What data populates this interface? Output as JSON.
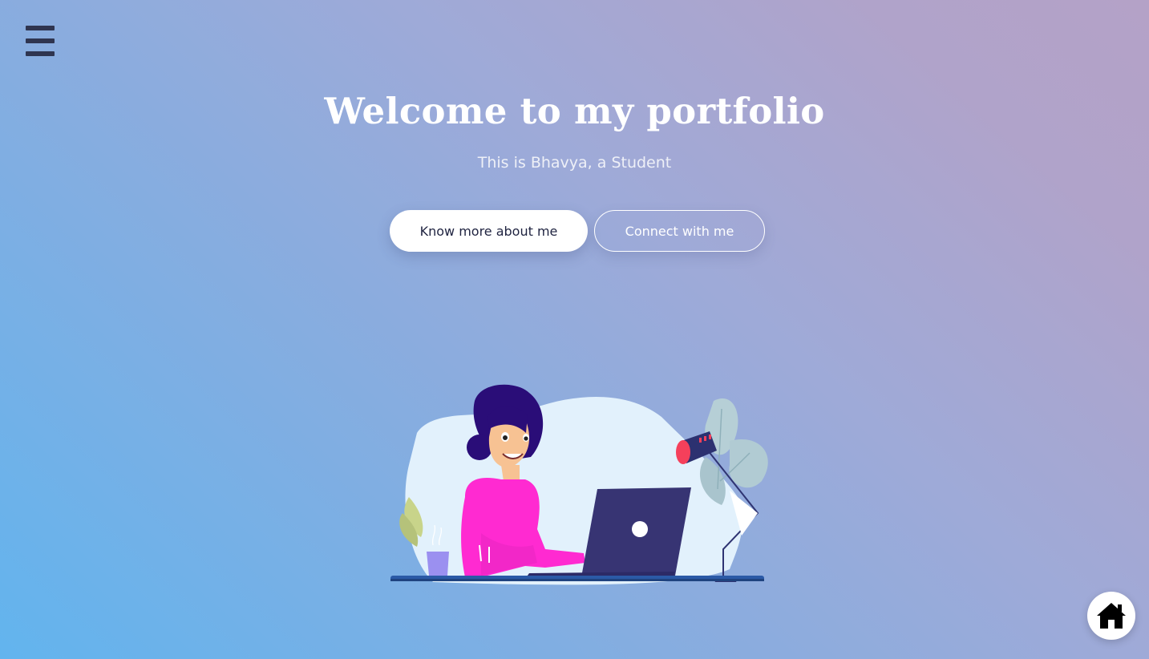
{
  "hero": {
    "title": "Welcome to my portfolio",
    "subtitle": "This is Bhavya, a Student"
  },
  "buttons": {
    "primary_label": "Know more about me",
    "secondary_label": "Connect with me"
  },
  "icons": {
    "menu": "hamburger-menu-icon",
    "home": "home-icon"
  },
  "colors": {
    "gradient_start": "#62b4ee",
    "gradient_end": "#b4a2c7",
    "menu_icon": "#2f3550",
    "primary_button_text": "#1f2340"
  }
}
